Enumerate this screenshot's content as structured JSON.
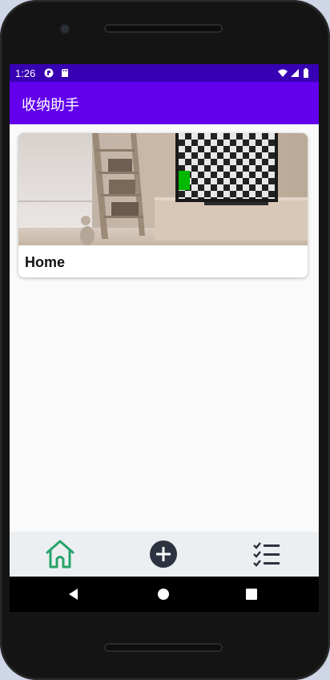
{
  "status_bar": {
    "time": "1:26",
    "icons": [
      "media-icon",
      "sd-card-icon",
      "wifi-icon",
      "signal-icon",
      "battery-icon"
    ]
  },
  "app_bar": {
    "title": "收纳助手"
  },
  "cards": [
    {
      "title": "Home",
      "image": "living-room-photo"
    }
  ],
  "bottom_nav": {
    "items": [
      "home-icon",
      "add-circle-icon",
      "checklist-icon"
    ],
    "active": "home-icon",
    "active_color": "#27a36a"
  },
  "system_nav": {
    "buttons": [
      "back-icon",
      "home-circle-icon",
      "recents-icon"
    ]
  },
  "colors": {
    "status_bar": "#3700b3",
    "app_bar": "#6200ee",
    "bottom_nav": "#eceff1"
  }
}
